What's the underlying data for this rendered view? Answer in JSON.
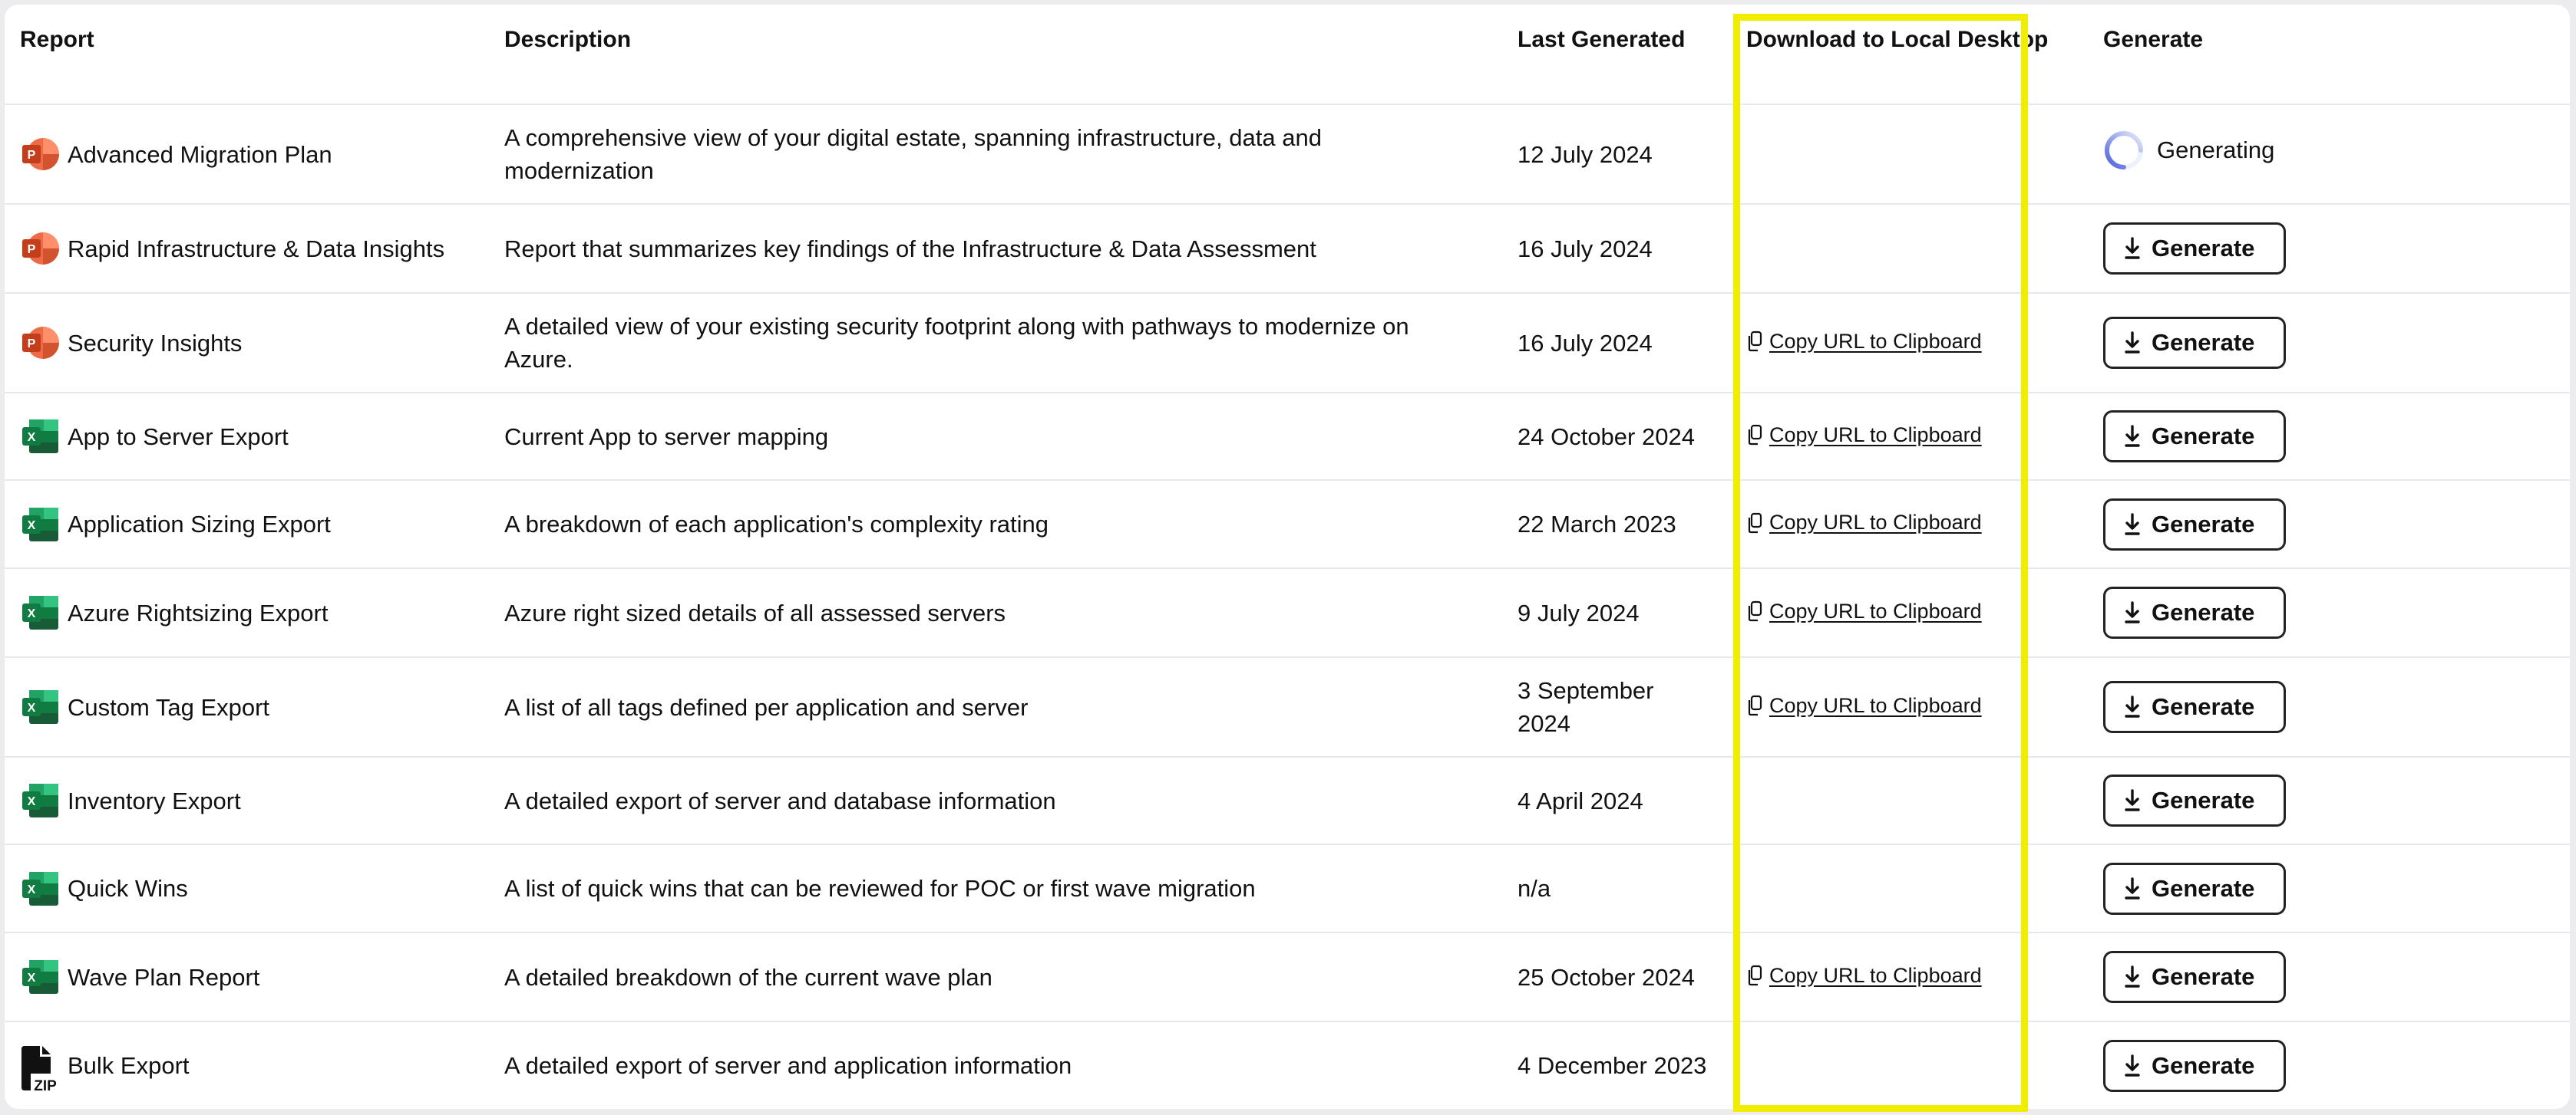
{
  "table": {
    "headers": {
      "report": "Report",
      "description": "Description",
      "last_generated": "Last Generated",
      "download": "Download to Local Desktop",
      "generate": "Generate"
    },
    "rows": [
      {
        "icon": "powerpoint-icon",
        "icon_letter": "P",
        "name": "Advanced Migration Plan",
        "description": "A comprehensive view of your digital estate, spanning infrastructure, data and modernization",
        "last_generated": "12 July 2024",
        "download": "",
        "status": "generating",
        "status_label": "Generating"
      },
      {
        "icon": "powerpoint-icon",
        "icon_letter": "P",
        "name": "Rapid Infrastructure & Data Insights",
        "description": "Report that summarizes key findings of the Infrastructure & Data Assessment",
        "last_generated": "16 July 2024",
        "download": "",
        "status": "idle",
        "button_label": "Generate"
      },
      {
        "icon": "powerpoint-icon",
        "icon_letter": "P",
        "name": "Security Insights",
        "description": "A detailed view of your existing security footprint along with pathways to modernize on Azure.",
        "last_generated": "16 July 2024",
        "download": "Copy URL to Clipboard",
        "status": "idle",
        "button_label": "Generate"
      },
      {
        "icon": "excel-icon",
        "icon_letter": "X",
        "name": "App to Server Export",
        "description": "Current App to server mapping",
        "last_generated": "24 October 2024",
        "download": "Copy URL to Clipboard",
        "status": "idle",
        "button_label": "Generate"
      },
      {
        "icon": "excel-icon",
        "icon_letter": "X",
        "name": "Application Sizing Export",
        "description": "A breakdown of each application's complexity rating",
        "last_generated": "22 March 2023",
        "download": "Copy URL to Clipboard",
        "status": "idle",
        "button_label": "Generate"
      },
      {
        "icon": "excel-icon",
        "icon_letter": "X",
        "name": "Azure Rightsizing Export",
        "description": "Azure right sized details of all assessed servers",
        "last_generated": "9 July 2024",
        "download": "Copy URL to Clipboard",
        "status": "idle",
        "button_label": "Generate"
      },
      {
        "icon": "excel-icon",
        "icon_letter": "X",
        "name": "Custom Tag Export",
        "description": "A list of all tags defined per application and server",
        "last_generated": "3 September 2024",
        "download": "Copy URL to Clipboard",
        "status": "idle",
        "button_label": "Generate"
      },
      {
        "icon": "excel-icon",
        "icon_letter": "X",
        "name": "Inventory Export",
        "description": "A detailed export of server and database information",
        "last_generated": "4 April 2024",
        "download": "",
        "status": "idle",
        "button_label": "Generate"
      },
      {
        "icon": "excel-icon",
        "icon_letter": "X",
        "name": "Quick Wins",
        "description": "A list of quick wins that can be reviewed for POC or first wave migration",
        "last_generated": "n/a",
        "download": "",
        "status": "idle",
        "button_label": "Generate"
      },
      {
        "icon": "excel-icon",
        "icon_letter": "X",
        "name": "Wave Plan Report",
        "description": "A detailed breakdown of the current wave plan",
        "last_generated": "25 October 2024",
        "download": "Copy URL to Clipboard",
        "status": "idle",
        "button_label": "Generate"
      },
      {
        "icon": "zip-icon",
        "icon_letter": "ZIP",
        "name": "Bulk Export",
        "description": "A detailed export of server and application information",
        "last_generated": "4 December 2023",
        "download": "",
        "status": "idle",
        "button_label": "Generate"
      }
    ]
  },
  "colors": {
    "highlight": "#f2ec00",
    "powerpoint": "#d04423",
    "excel": "#107c41",
    "spinner": "#5b6fe0"
  }
}
